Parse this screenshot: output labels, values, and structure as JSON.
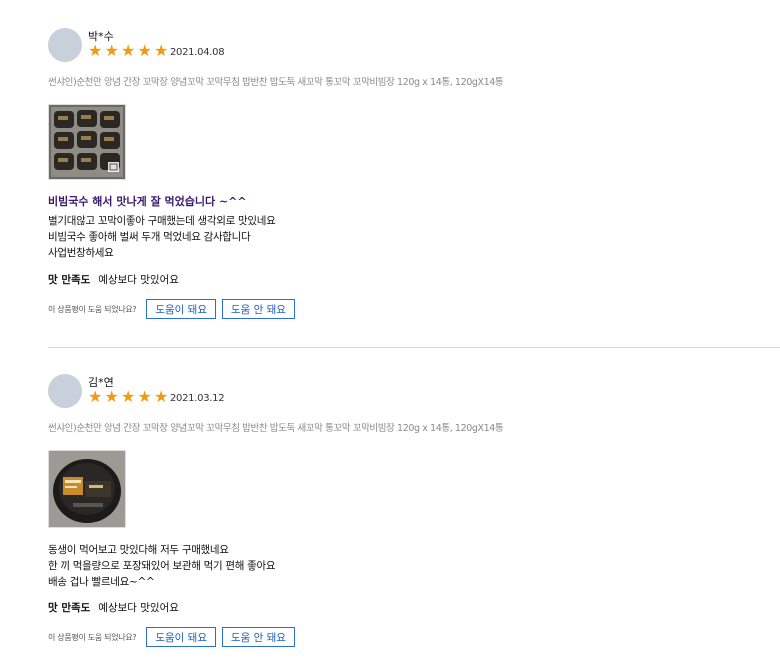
{
  "colors": {
    "star": "#f29a11",
    "headline": "#3a1a6e",
    "button_border": "#2a6fd4",
    "avatar": "#c8d0dc"
  },
  "reviews": [
    {
      "name": "박*수",
      "rating": 5,
      "stars": "★★★★★",
      "date": "2021.04.08",
      "product": "썬샤인)순천만 앙념 간장 꼬막장 양념꼬막 꼬막무침 밥반찬 밥도둑 새꼬막 통꼬막 꼬막비빔장 120g x 14통, 120gX14통",
      "headline": "비빔국수 해서 맛나게 잘 먹었습니다 ~^^",
      "body": [
        "별기대않고 꼬막이좋아 구매했는데 생각외로 맛있네요",
        "비빔국수 좋아해 벌써 두개 먹었네요 감사합니다",
        "사업번창하세요"
      ],
      "taste_label": "맛 만족도",
      "taste_value": "예상보다 맛있어요",
      "helpful_q": "이 상품평이 도움 되었나요?",
      "helpful_yes": "도움이 돼요",
      "helpful_no": "도움 안 돼요"
    },
    {
      "name": "김*연",
      "rating": 5,
      "stars": "★★★★★",
      "date": "2021.03.12",
      "product": "썬샤인)순천만 앙념 간장 꼬막장 양념꼬막 꼬막무침 밥반찬 밥도둑 새꼬막 통꼬막 꼬막비빔장 120g x 14통, 120gX14통",
      "headline": "",
      "body": [
        "동생이 먹어보고 맛있다해 저두 구매했네요",
        "한 끼 먹을량으로 포장돼있어 보관해 먹기 편해 좋아요",
        "배송 겁나 빨르네요~^^"
      ],
      "taste_label": "맛 만족도",
      "taste_value": "예상보다 맛있어요",
      "helpful_q": "이 상품평이 도움 되었나요?",
      "helpful_yes": "도움이 돼요",
      "helpful_no": "도움 안 돼요"
    }
  ]
}
